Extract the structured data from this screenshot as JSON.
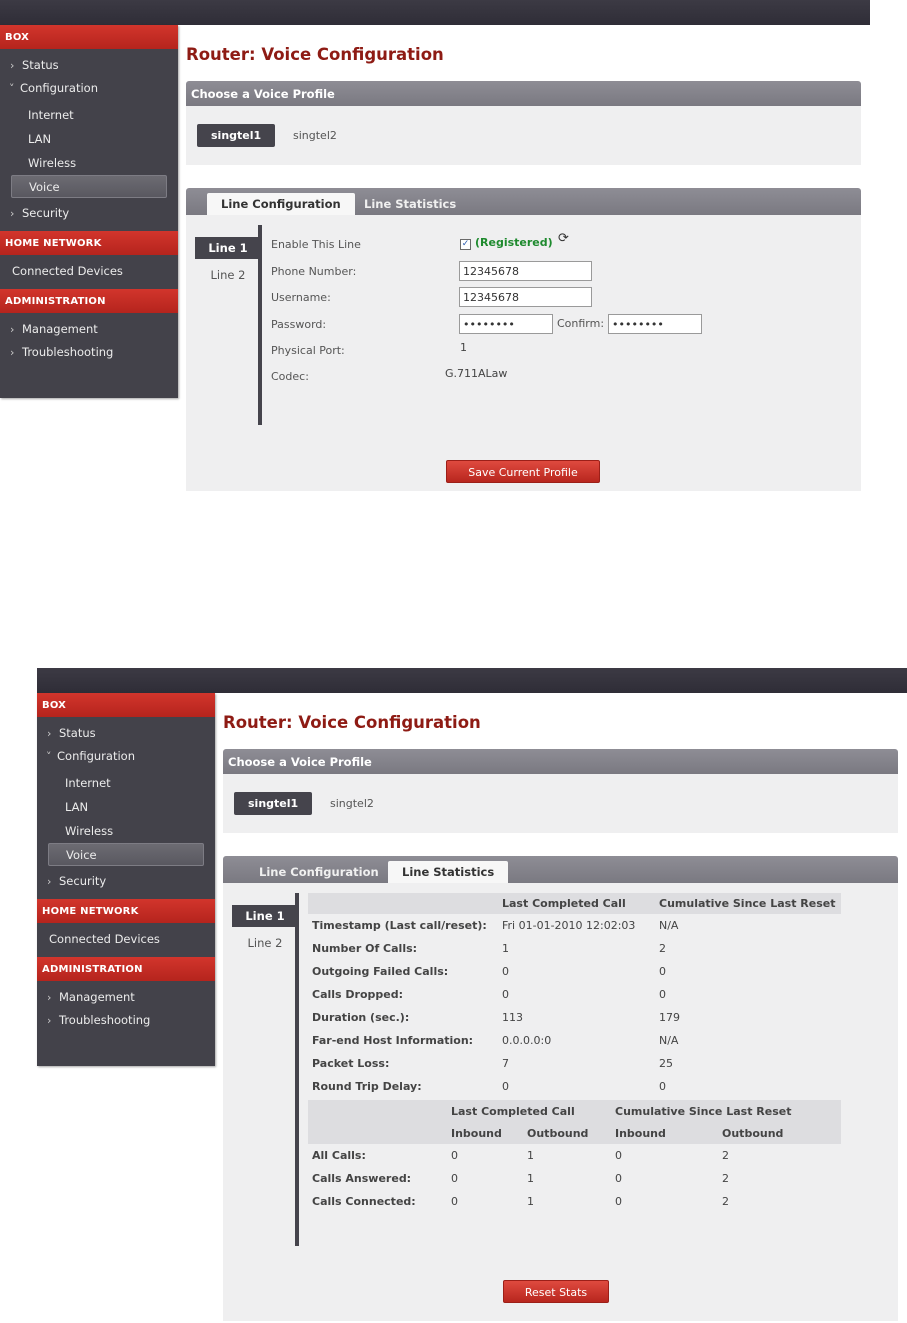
{
  "sidebar": {
    "box_header": "BOX",
    "status": "Status",
    "configuration": "Configuration",
    "internet": "Internet",
    "lan": "LAN",
    "wireless": "Wireless",
    "voice": "Voice",
    "security": "Security",
    "home_network_header": "HOME NETWORK",
    "connected_devices": "Connected Devices",
    "administration_header": "ADMINISTRATION",
    "management": "Management",
    "troubleshooting": "Troubleshooting"
  },
  "page_title": "Router: Voice Configuration",
  "profile": {
    "header": "Choose a Voice Profile",
    "selected": "singtel1",
    "other": "singtel2"
  },
  "tabs": {
    "line_configuration": "Line Configuration",
    "line_statistics": "Line Statistics"
  },
  "lines": {
    "line1": "Line 1",
    "line2": "Line 2"
  },
  "config": {
    "enable_label": "Enable This Line",
    "registered": "(Registered)",
    "phone_label": "Phone Number:",
    "phone_value": "12345678",
    "username_label": "Username:",
    "username_value": "12345678",
    "password_label": "Password:",
    "password_value": "••••••••",
    "confirm_label": "Confirm:",
    "confirm_value": "••••••••",
    "port_label": "Physical Port:",
    "port_value": "1",
    "codec_label": "Codec:",
    "codec_value": "G.711ALaw",
    "save_button": "Save Current Profile"
  },
  "stats": {
    "col_last": "Last Completed Call",
    "col_cumulative": "Cumulative Since Last Reset",
    "rows": [
      {
        "label": "Timestamp (Last call/reset):",
        "last": "Fri 01-01-2010 12:02:03",
        "cum": "N/A"
      },
      {
        "label": "Number Of Calls:",
        "last": "1",
        "cum": "2"
      },
      {
        "label": "Outgoing Failed Calls:",
        "last": "0",
        "cum": "0"
      },
      {
        "label": "Calls Dropped:",
        "last": "0",
        "cum": "0"
      },
      {
        "label": "Duration (sec.):",
        "last": "113",
        "cum": "179"
      },
      {
        "label": "Far-end Host Information:",
        "last": "0.0.0.0:0",
        "cum": "N/A"
      },
      {
        "label": "Packet Loss:",
        "last": "7",
        "cum": "25"
      },
      {
        "label": "Round Trip Delay:",
        "last": "0",
        "cum": "0"
      }
    ],
    "inbound": "Inbound",
    "outbound": "Outbound",
    "rows2": [
      {
        "label": "All Calls:",
        "last_in": "0",
        "last_out": "1",
        "cum_in": "0",
        "cum_out": "2"
      },
      {
        "label": "Calls Answered:",
        "last_in": "0",
        "last_out": "1",
        "cum_in": "0",
        "cum_out": "2"
      },
      {
        "label": "Calls Connected:",
        "last_in": "0",
        "last_out": "1",
        "cum_in": "0",
        "cum_out": "2"
      }
    ],
    "reset_button": "Reset Stats"
  }
}
